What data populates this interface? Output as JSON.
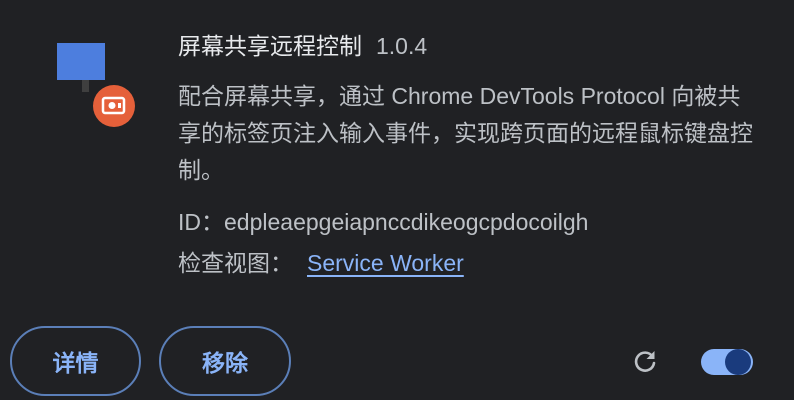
{
  "extension": {
    "name": "屏幕共享远程控制",
    "version": "1.0.4",
    "description": "配合屏幕共享，通过 Chrome DevTools Protocol 向被共享的标签页注入输入事件，实现跨页面的远程鼠标键盘控制。",
    "id_label": "ID：",
    "id_value": "edpleaepgeiapnccdikeogcpdocoilgh",
    "inspect_label": "检查视图：",
    "inspect_link": "Service Worker",
    "enabled": true
  },
  "buttons": {
    "details": "详情",
    "remove": "移除"
  },
  "icons": {
    "extension": "monitor-remote-icon",
    "reload": "reload-icon",
    "toggle": "toggle-switch"
  },
  "colors": {
    "background": "#202124",
    "accent": "#8ab4f8",
    "icon_blue": "#4d7ede",
    "badge_orange": "#e5603a"
  }
}
